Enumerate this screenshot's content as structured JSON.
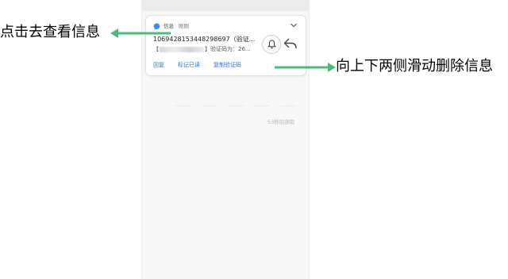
{
  "colors": {
    "annotation_arrow": "#4cbb7a",
    "action_link": "#2c72d8",
    "app_icon": "#3d8bf0"
  },
  "notification": {
    "app_icon": "message-bubble-icon",
    "app_name": "信息",
    "time": "刚刚",
    "sender": "1069428153448298697（验证...",
    "preview_prefix": "【",
    "preview_suffix": "】验证码为：26...",
    "actions": [
      "回复",
      "标记已读",
      "复制验证码"
    ],
    "icons": [
      "bell-icon",
      "reply-arrow-icon",
      "chevron-down-icon"
    ]
  },
  "countdown_text": "53秒后获取",
  "annotations": {
    "left_label": "点击去查看信息",
    "right_label": "向上下两侧滑动删除信息"
  }
}
